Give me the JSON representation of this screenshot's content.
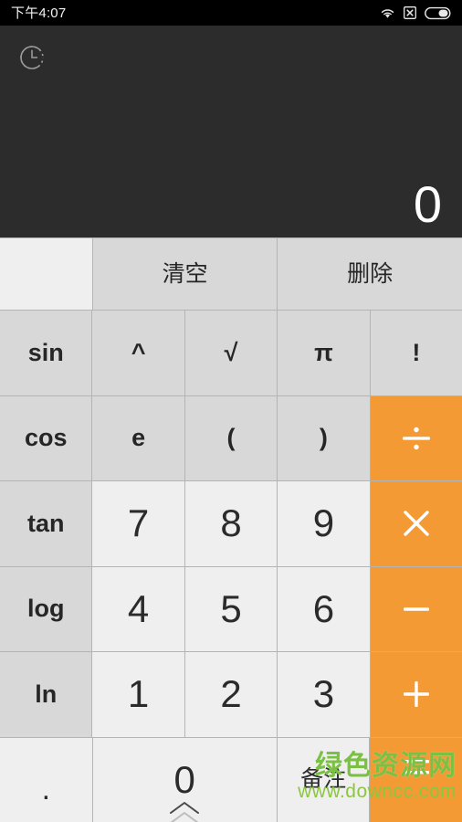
{
  "status_bar": {
    "time": "下午4:07",
    "icons": [
      "wifi-icon",
      "no-sim-icon",
      "battery-icon"
    ]
  },
  "display": {
    "history_icon": "history-clock-icon",
    "expression": "",
    "value": "0"
  },
  "keypad": {
    "rows": [
      {
        "id": "row-clear",
        "keys": [
          {
            "name": "key-blank",
            "label": "",
            "style": "k-light",
            "text": "k-cn",
            "interactable": false
          },
          {
            "name": "key-clear",
            "label": "清空",
            "style": "k-gray",
            "text": "k-cn",
            "interactable": true
          },
          {
            "name": "key-delete",
            "label": "删除",
            "style": "k-gray",
            "text": "k-cn",
            "interactable": true
          }
        ]
      },
      {
        "id": "row-1",
        "keys": [
          {
            "name": "key-sin",
            "label": "sin",
            "style": "k-gray",
            "text": "k-func",
            "interactable": true
          },
          {
            "name": "key-power",
            "label": "^",
            "style": "k-gray",
            "text": "k-sym",
            "interactable": true
          },
          {
            "name": "key-sqrt",
            "label": "√",
            "style": "k-gray",
            "text": "k-sym",
            "interactable": true
          },
          {
            "name": "key-pi",
            "label": "π",
            "style": "k-gray",
            "text": "k-sym",
            "interactable": true
          },
          {
            "name": "key-factorial",
            "label": "!",
            "style": "k-gray",
            "text": "k-sym",
            "interactable": true
          }
        ]
      },
      {
        "id": "row-2",
        "keys": [
          {
            "name": "key-cos",
            "label": "cos",
            "style": "k-gray",
            "text": "k-func",
            "interactable": true
          },
          {
            "name": "key-e",
            "label": "e",
            "style": "k-gray",
            "text": "k-sym",
            "interactable": true
          },
          {
            "name": "key-paren-open",
            "label": "(",
            "style": "k-gray",
            "text": "k-sym",
            "interactable": true
          },
          {
            "name": "key-paren-close",
            "label": ")",
            "style": "k-gray",
            "text": "k-sym",
            "interactable": true
          },
          {
            "name": "key-divide",
            "label": "÷",
            "style": "k-orange",
            "text": "k-op",
            "interactable": true
          }
        ]
      },
      {
        "id": "row-3",
        "keys": [
          {
            "name": "key-tan",
            "label": "tan",
            "style": "k-gray",
            "text": "k-func",
            "interactable": true
          },
          {
            "name": "key-7",
            "label": "7",
            "style": "k-light",
            "text": "k-digit",
            "interactable": true
          },
          {
            "name": "key-8",
            "label": "8",
            "style": "k-light",
            "text": "k-digit",
            "interactable": true
          },
          {
            "name": "key-9",
            "label": "9",
            "style": "k-light",
            "text": "k-digit",
            "interactable": true
          },
          {
            "name": "key-multiply",
            "label": "×",
            "style": "k-orange",
            "text": "k-op",
            "interactable": true
          }
        ]
      },
      {
        "id": "row-4",
        "keys": [
          {
            "name": "key-log",
            "label": "log",
            "style": "k-gray",
            "text": "k-func",
            "interactable": true
          },
          {
            "name": "key-4",
            "label": "4",
            "style": "k-light",
            "text": "k-digit",
            "interactable": true
          },
          {
            "name": "key-5",
            "label": "5",
            "style": "k-light",
            "text": "k-digit",
            "interactable": true
          },
          {
            "name": "key-6",
            "label": "6",
            "style": "k-light",
            "text": "k-digit",
            "interactable": true
          },
          {
            "name": "key-subtract",
            "label": "−",
            "style": "k-orange",
            "text": "k-op",
            "interactable": true
          }
        ]
      },
      {
        "id": "row-5",
        "keys": [
          {
            "name": "key-ln",
            "label": "ln",
            "style": "k-gray",
            "text": "k-func",
            "interactable": true
          },
          {
            "name": "key-1",
            "label": "1",
            "style": "k-light",
            "text": "k-digit",
            "interactable": true
          },
          {
            "name": "key-2",
            "label": "2",
            "style": "k-light",
            "text": "k-digit",
            "interactable": true
          },
          {
            "name": "key-3",
            "label": "3",
            "style": "k-light",
            "text": "k-digit",
            "interactable": true
          },
          {
            "name": "key-add",
            "label": "+",
            "style": "k-orange",
            "text": "k-op",
            "interactable": true
          }
        ]
      },
      {
        "id": "row-6",
        "keys": [
          {
            "name": "key-decimal",
            "label": ".",
            "style": "k-light",
            "text": "k-digit",
            "interactable": true
          },
          {
            "name": "key-0",
            "label": "0",
            "style": "k-light",
            "text": "k-digit",
            "interactable": true
          },
          {
            "name": "key-note",
            "label": "备注",
            "style": "k-light",
            "text": "k-cn",
            "interactable": true
          },
          {
            "name": "key-equals",
            "label": "=",
            "style": "k-orange",
            "text": "k-op",
            "interactable": true
          }
        ]
      }
    ],
    "expand_handle_icon": "chevron-double-up-icon"
  },
  "watermark": {
    "title": "绿色资源网",
    "url": "www.downcc.com"
  },
  "colors": {
    "display_bg": "#2c2c2c",
    "status_bg": "#000000",
    "key_light": "#efefef",
    "key_gray": "#d8d8d8",
    "key_orange": "#f49a35",
    "divider": "#b4b4b4",
    "watermark_green": "#7ac143"
  }
}
